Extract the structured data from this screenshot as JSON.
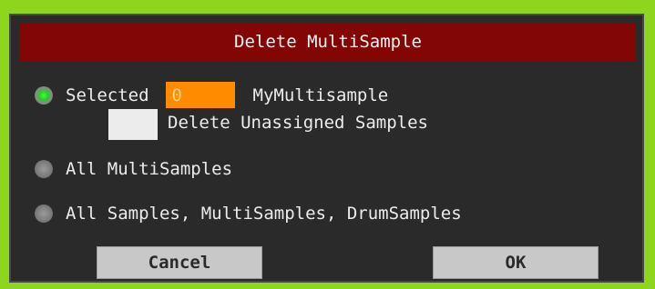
{
  "dialog": {
    "title": "Delete MultiSample",
    "options": [
      {
        "label": "Selected",
        "selected": true
      },
      {
        "label": "All MultiSamples",
        "selected": false
      },
      {
        "label": "All Samples, MultiSamples, DrumSamples",
        "selected": false
      }
    ],
    "selected_index_value": "0",
    "selected_name": "MyMultisample",
    "delete_unassigned_label": "Delete Unassigned Samples",
    "delete_unassigned_checked": false,
    "cancel_label": "Cancel",
    "ok_label": "OK",
    "colors": {
      "background": "#8ed61e",
      "title_bar": "#820606",
      "dialog_body": "#2a2a2a",
      "index_field": "#ff8c00",
      "radio_active": "#22d022",
      "button": "#c8c8c8"
    }
  }
}
